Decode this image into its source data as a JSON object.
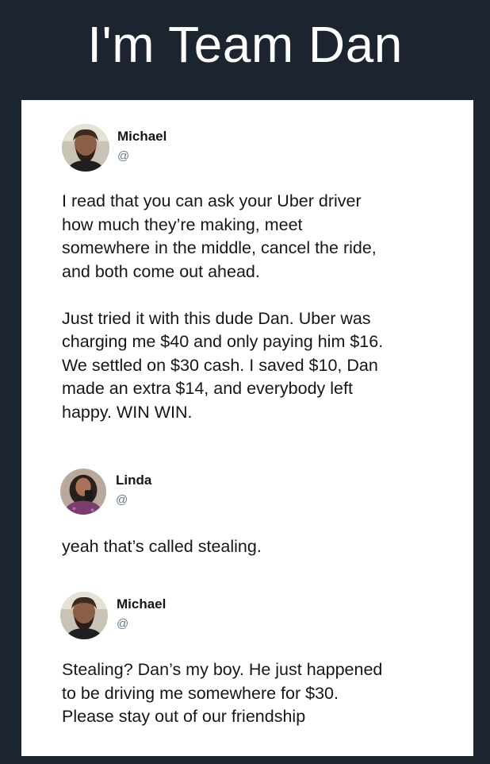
{
  "meme": {
    "title": "I'm Team Dan"
  },
  "thread": [
    {
      "name": "Michael",
      "handle": "@",
      "avatar_icon": "bearded-man-avatar-icon",
      "text": "I read that you can ask your Uber driver\nhow much they’re making, meet\nsomewhere in the middle, cancel the ride,\nand both come out ahead.\n\nJust tried it with this dude Dan. Uber was\ncharging me $40 and only paying him $16.\nWe settled on $30 cash. I saved $10, Dan\nmade an extra $14, and everybody left\nhappy. WIN WIN."
    },
    {
      "name": "Linda",
      "handle": "@",
      "avatar_icon": "woman-selfie-avatar-icon",
      "text": "yeah that’s called stealing."
    },
    {
      "name": "Michael",
      "handle": "@",
      "avatar_icon": "bearded-man-avatar-icon",
      "text": "Stealing? Dan’s my boy. He just happened\nto be driving me somewhere for $30.\nPlease stay out of our friendship"
    }
  ],
  "colors": {
    "background": "#1c2430",
    "card": "#ffffff",
    "text": "#14171a",
    "handle": "#657786"
  }
}
